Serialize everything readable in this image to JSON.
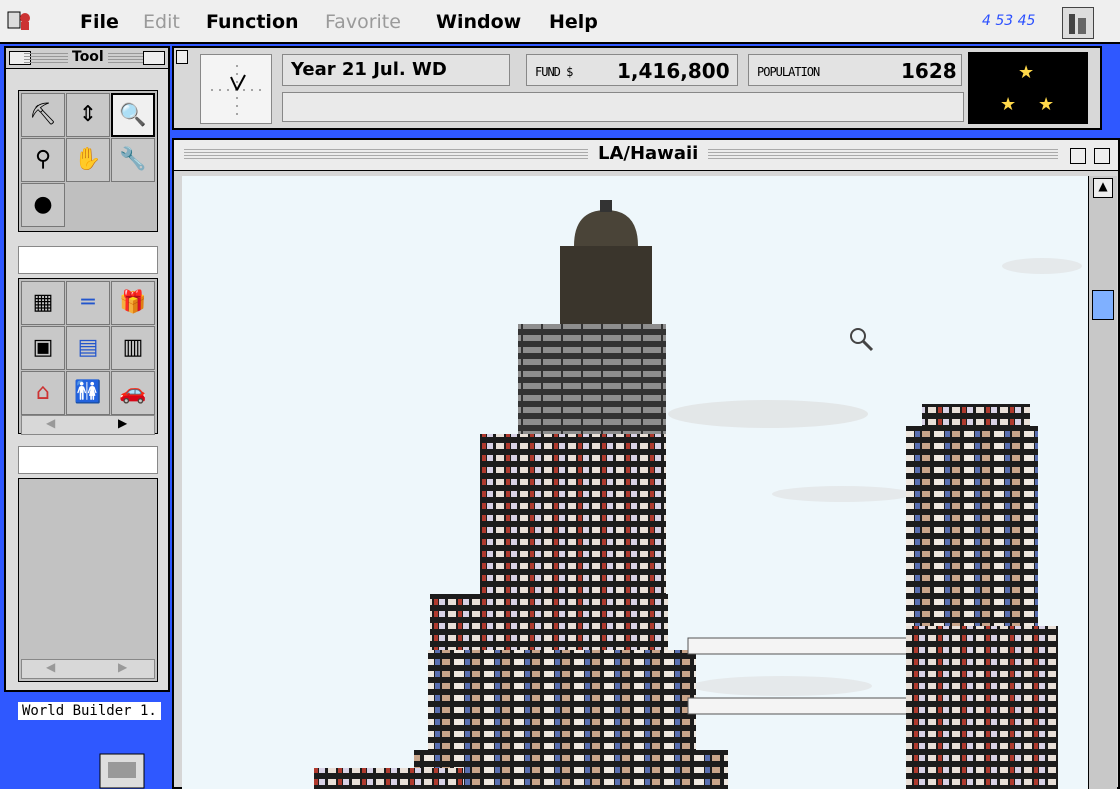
{
  "menubar": {
    "items": [
      {
        "label": "File",
        "enabled": true
      },
      {
        "label": "Edit",
        "enabled": false
      },
      {
        "label": "Function",
        "enabled": true
      },
      {
        "label": "Favorite",
        "enabled": false
      },
      {
        "label": "Window",
        "enabled": true
      },
      {
        "label": "Help",
        "enabled": true
      }
    ],
    "clock": "4 53 45"
  },
  "tool_palette": {
    "title": "Tool",
    "tools_top": [
      "bulldozer-icon",
      "elevator-icon",
      "magnifier-icon",
      "telescope-icon",
      "hand-icon",
      "repair-wrench-icon",
      "rocks-icon"
    ],
    "buildings": [
      "office-icon",
      "pipe-icon",
      "gift-shop-icon",
      "condo-icon",
      "hotel-icon",
      "retail-icon",
      "restaurant-icon",
      "restroom-icon",
      "movie-icon"
    ]
  },
  "info": {
    "date": "Year 21 Jul. WD",
    "fund_label": "FUND $",
    "fund_value": "1,416,800",
    "population_label": "POPULATION",
    "population_value": "1628",
    "stars": 3
  },
  "city_window": {
    "title": "LA/Hawaii"
  },
  "desktop": {
    "label": "World Builder 1."
  },
  "colors": {
    "desktop": "#2f58ff",
    "sky": "#eef7fb",
    "tower": "#2a2a2a"
  }
}
